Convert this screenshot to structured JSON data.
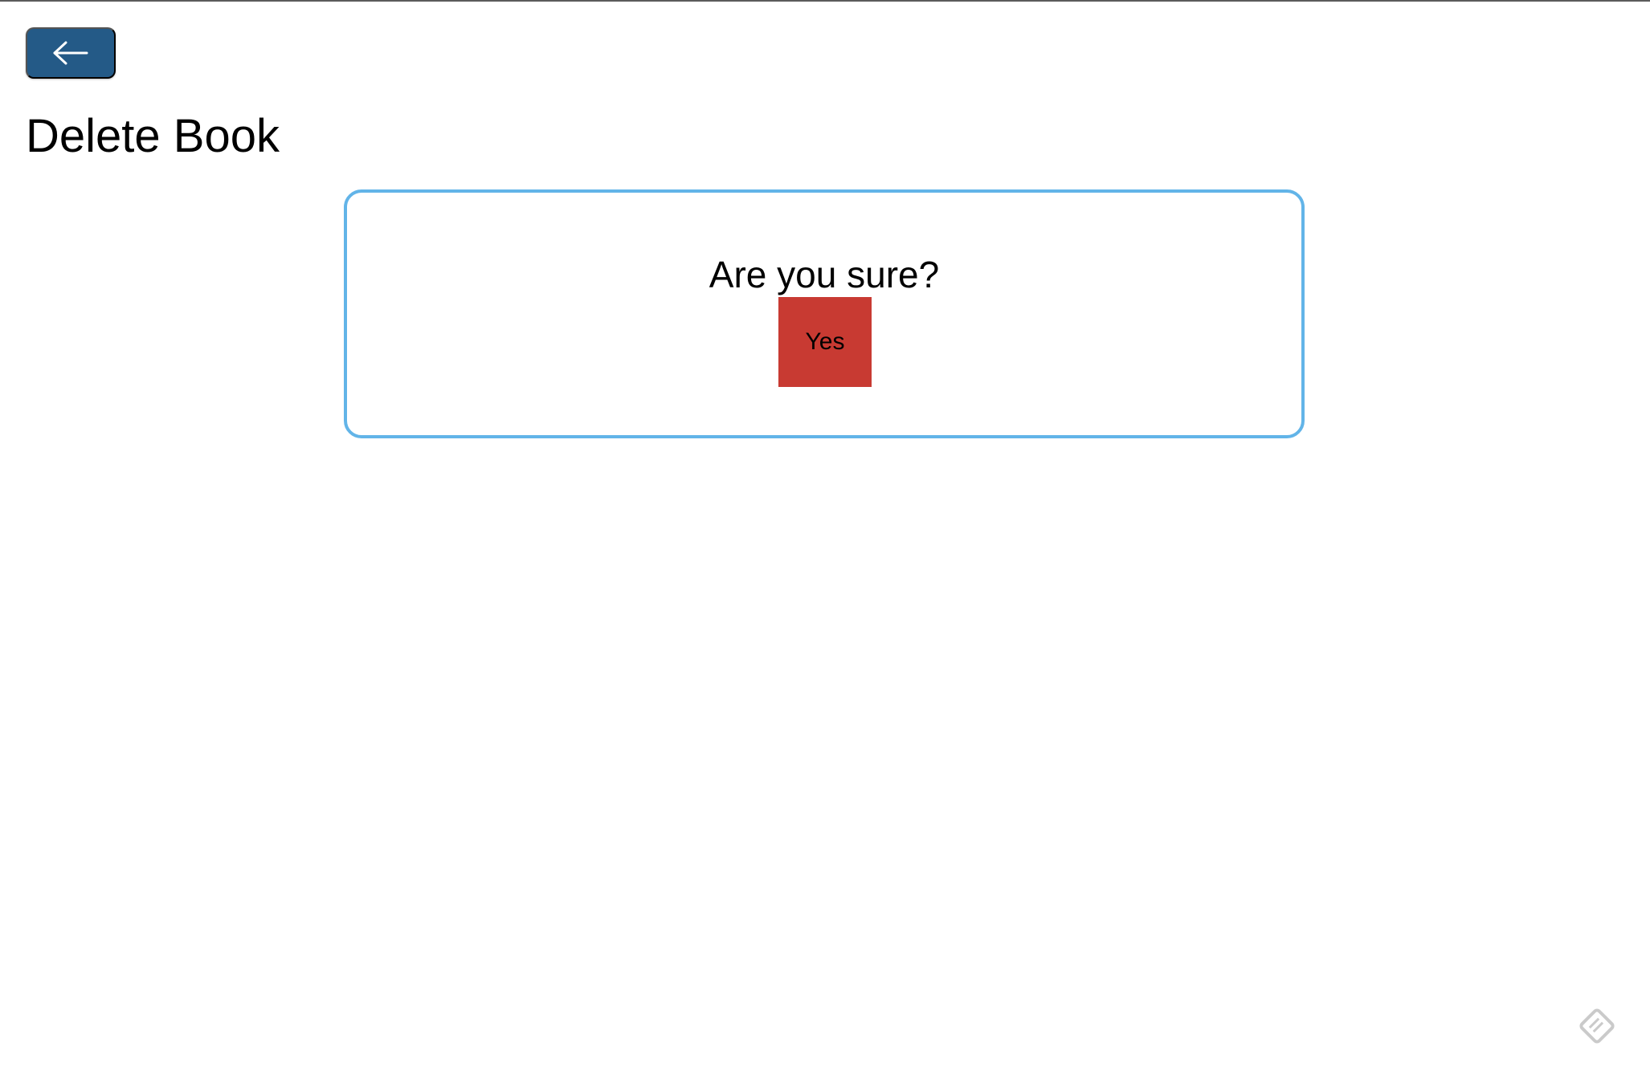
{
  "header": {
    "back_button": {
      "icon": "arrow-left-icon",
      "color": "#245a87"
    },
    "title": "Delete Book"
  },
  "dialog": {
    "question": "Are you sure?",
    "confirm_label": "Yes",
    "border_color": "#62b4e8",
    "confirm_color": "#c83a32"
  },
  "corner_icon": "feedback-icon"
}
